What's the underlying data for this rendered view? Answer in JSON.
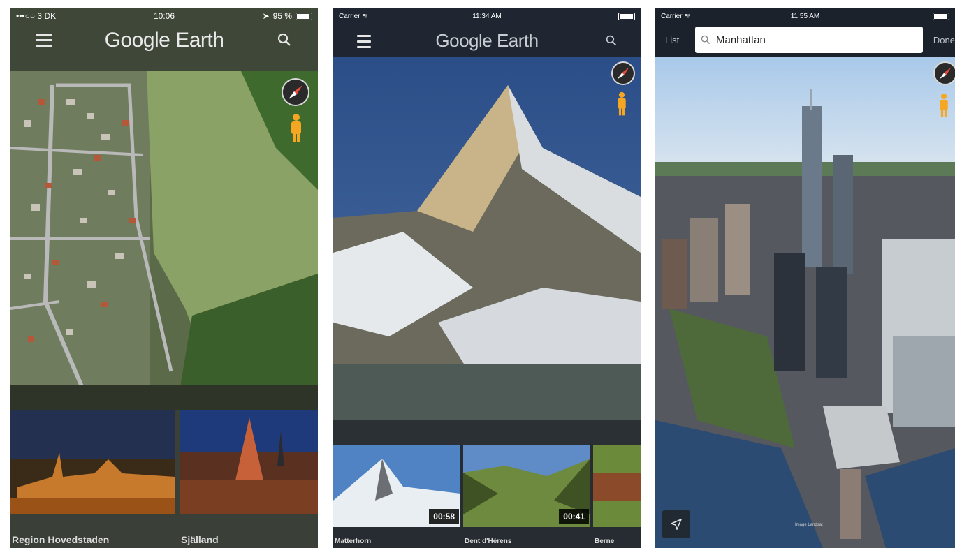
{
  "screen1": {
    "status": {
      "carrier": "•••○○ 3 DK",
      "time": "10:06",
      "battery": "95 %",
      "battery_level": 0.95
    },
    "app_title": "Google Earth",
    "cards": [
      {
        "label": "Region Hovedstaden"
      },
      {
        "label": "Själland"
      }
    ]
  },
  "screen2": {
    "status": {
      "carrier": "Carrier",
      "time": "11:34 AM"
    },
    "app_title": "Google Earth",
    "cards": [
      {
        "label": "Matterhorn",
        "duration": "00:58"
      },
      {
        "label": "Dent d'Hérens",
        "duration": "00:41"
      },
      {
        "label": "Berne"
      }
    ]
  },
  "screen3": {
    "status": {
      "carrier": "Carrier",
      "time": "11:55 AM"
    },
    "list_label": "List",
    "search_value": "Manhattan",
    "done_label": "Done",
    "attribution": "Image Landsat"
  },
  "colors": {
    "appbar": "#3a3f45",
    "text_light": "#e9e9ea",
    "pegman": "#f5a623"
  },
  "icons": [
    "menu-icon",
    "search-icon",
    "compass-icon",
    "pegman-icon",
    "locate-arrow-icon",
    "wifi-icon",
    "location-arrow-icon"
  ]
}
